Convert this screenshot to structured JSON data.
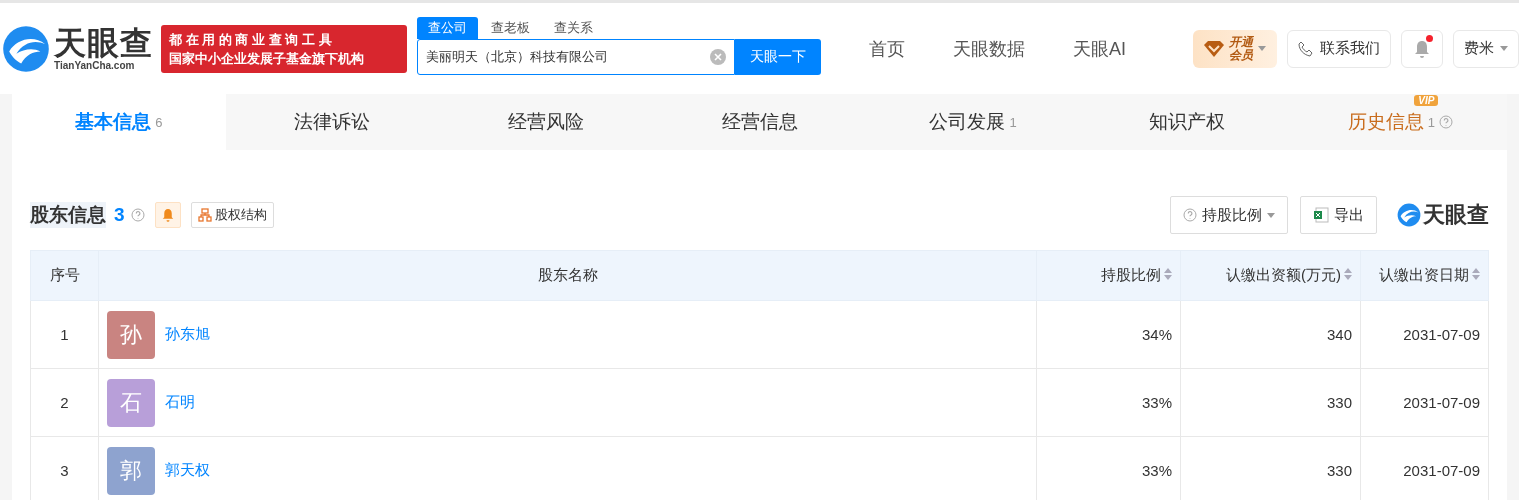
{
  "header": {
    "logo": {
      "name": "天眼查",
      "domain": "TianYanCha.com"
    },
    "slogan": [
      "都 在 用 的 商 业 查 询 工 具",
      "国家中小企业发展子基金旗下机构"
    ],
    "search_tabs": [
      {
        "label": "查公司",
        "selected": true
      },
      {
        "label": "查老板",
        "selected": false
      },
      {
        "label": "查关系",
        "selected": false
      }
    ],
    "search": {
      "value": "美丽明天（北京）科技有限公司",
      "button": "天眼一下"
    },
    "nav": [
      "首页",
      "天眼数据",
      "天眼AI"
    ],
    "vip": {
      "label": "开通会员"
    },
    "contact": "联系我们",
    "notification": {
      "unread": true
    },
    "user": "费米"
  },
  "tabs": [
    {
      "label": "基本信息",
      "count": "6",
      "selected": true,
      "vip": false
    },
    {
      "label": "法律诉讼",
      "selected": false,
      "vip": false
    },
    {
      "label": "经营风险",
      "selected": false,
      "vip": false
    },
    {
      "label": "经营信息",
      "selected": false,
      "vip": false
    },
    {
      "label": "公司发展",
      "count": "1",
      "selected": false,
      "vip": false
    },
    {
      "label": "知识产权",
      "selected": false,
      "vip": false
    },
    {
      "label": "历史信息",
      "count": "1",
      "selected": false,
      "vip": true,
      "badge": "VIP"
    }
  ],
  "section": {
    "title": "股东信息",
    "count": "3",
    "structure_button": "股权结构",
    "filter_button": "持股比例",
    "export_button": "导出",
    "brand": "天眼查"
  },
  "table": {
    "columns": [
      {
        "label": "序号",
        "sortable": false
      },
      {
        "label": "股东名称",
        "sortable": false
      },
      {
        "label": "持股比例",
        "sortable": true
      },
      {
        "label": "认缴出资额(万元)",
        "sortable": true
      },
      {
        "label": "认缴出资日期",
        "sortable": true
      }
    ],
    "rows": [
      {
        "index": "1",
        "avatar": "孙",
        "color": "#c98481",
        "name": "孙东旭",
        "share": "34%",
        "amount": "340",
        "date": "2031-07-09"
      },
      {
        "index": "2",
        "avatar": "石",
        "color": "#b89fd9",
        "name": "石明",
        "share": "33%",
        "amount": "330",
        "date": "2031-07-09"
      },
      {
        "index": "3",
        "avatar": "郭",
        "color": "#8ea3cf",
        "name": "郭天权",
        "share": "33%",
        "amount": "330",
        "date": "2031-07-09"
      }
    ]
  }
}
